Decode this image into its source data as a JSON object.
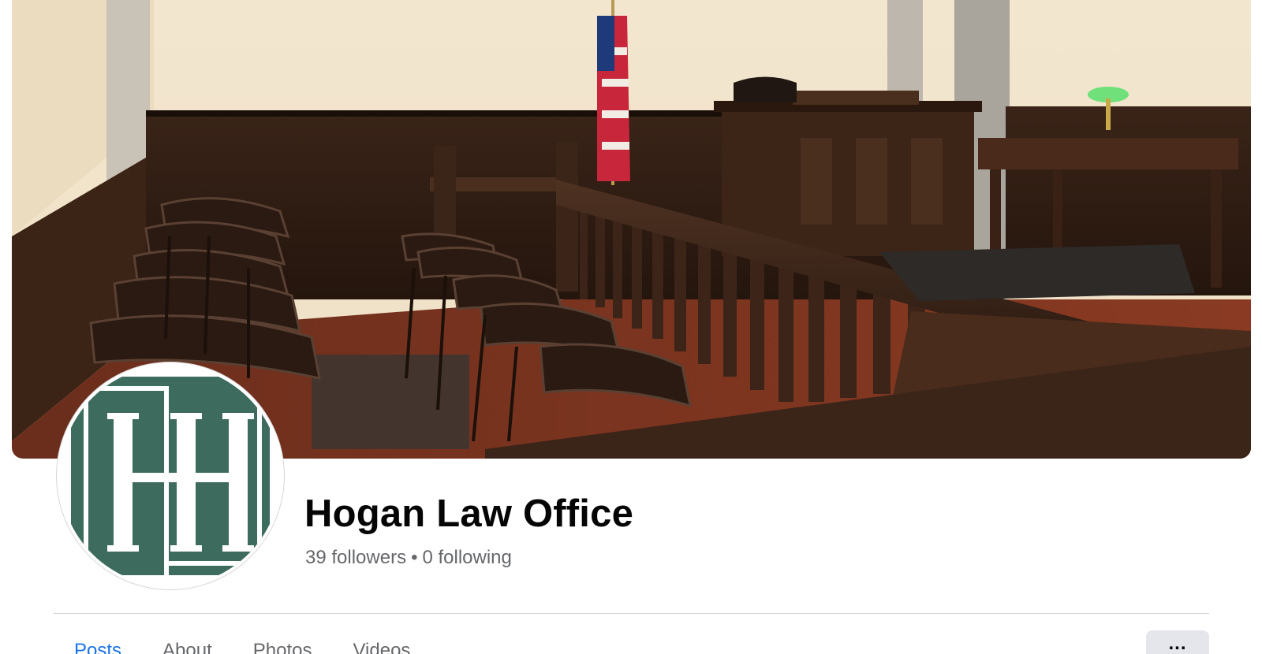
{
  "cover": {
    "icon": "courtroom-photo"
  },
  "profile": {
    "name": "Hogan Law Office",
    "followers": "39 followers",
    "separator": "•",
    "following": "0 following",
    "avatar_icon": "hlo-logo",
    "logo_color": "#3d6b5d"
  },
  "tabs": [
    {
      "label": "Posts",
      "active": true
    },
    {
      "label": "About",
      "active": false
    },
    {
      "label": "Photos",
      "active": false
    },
    {
      "label": "Videos",
      "active": false
    }
  ],
  "more_button": {
    "label": "...",
    "icon": "more-icon"
  },
  "colors": {
    "accent": "#1b74e4",
    "secondary_text": "#65676b",
    "primary_text": "#050505",
    "button_bg": "#e4e6eb"
  }
}
